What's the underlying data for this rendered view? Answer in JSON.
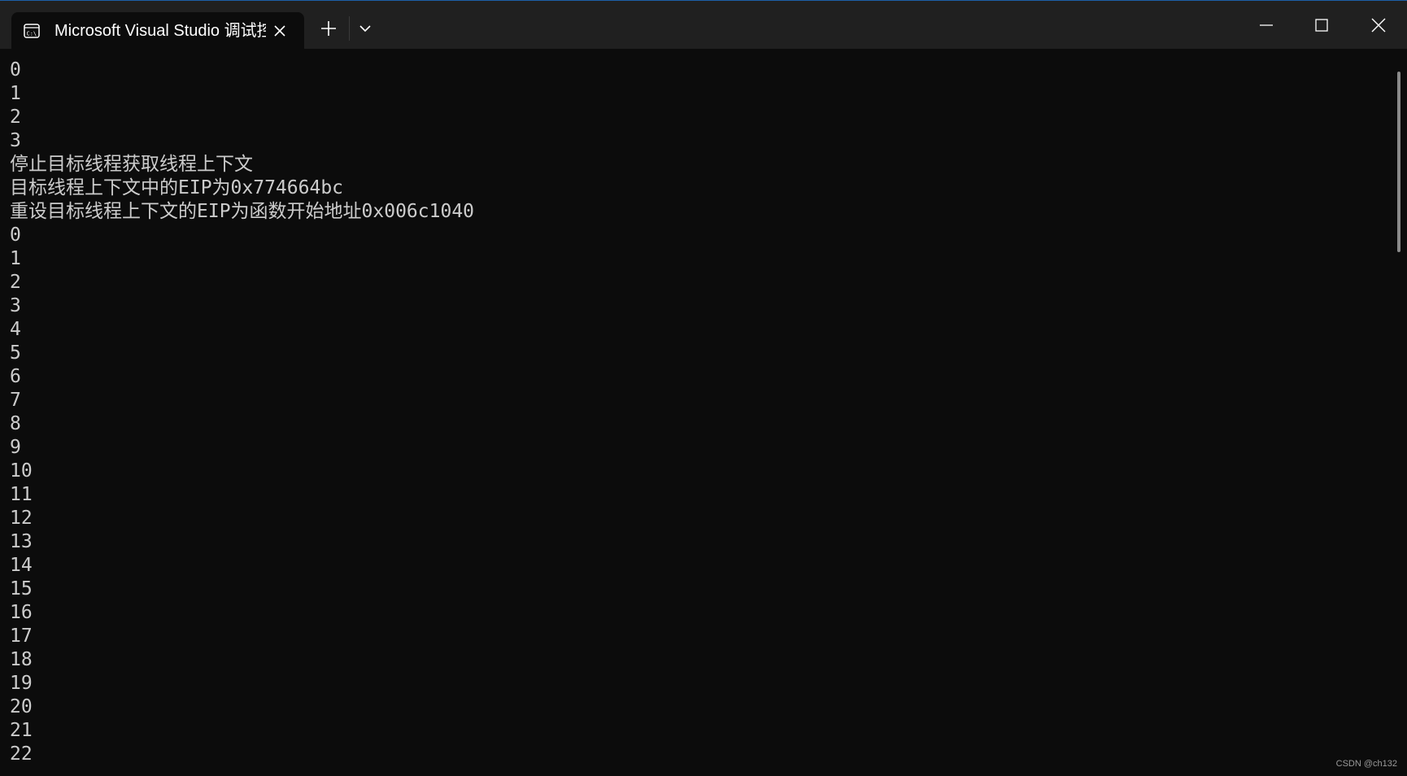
{
  "window": {
    "tab_title": "Microsoft Visual Studio 调试控制台",
    "tab_icon": "console-icon",
    "new_tab_icon": "plus-icon",
    "dropdown_icon": "chevron-down-icon",
    "controls": [
      "minimize-icon",
      "maximize-icon",
      "close-icon"
    ],
    "colors": {
      "titlebar": "#202020",
      "background": "#0c0c0c",
      "text": "#cccccc"
    }
  },
  "console": {
    "lines": [
      "0",
      "1",
      "2",
      "3",
      "停止目标线程获取线程上下文",
      "目标线程上下文中的EIP为0x774664bc",
      "重设目标线程上下文的EIP为函数开始地址0x006c1040",
      "0",
      "1",
      "2",
      "3",
      "4",
      "5",
      "6",
      "7",
      "8",
      "9",
      "10",
      "11",
      "12",
      "13",
      "14",
      "15",
      "16",
      "17",
      "18",
      "19",
      "20",
      "21",
      "22"
    ]
  },
  "watermark": "CSDN @ch132"
}
